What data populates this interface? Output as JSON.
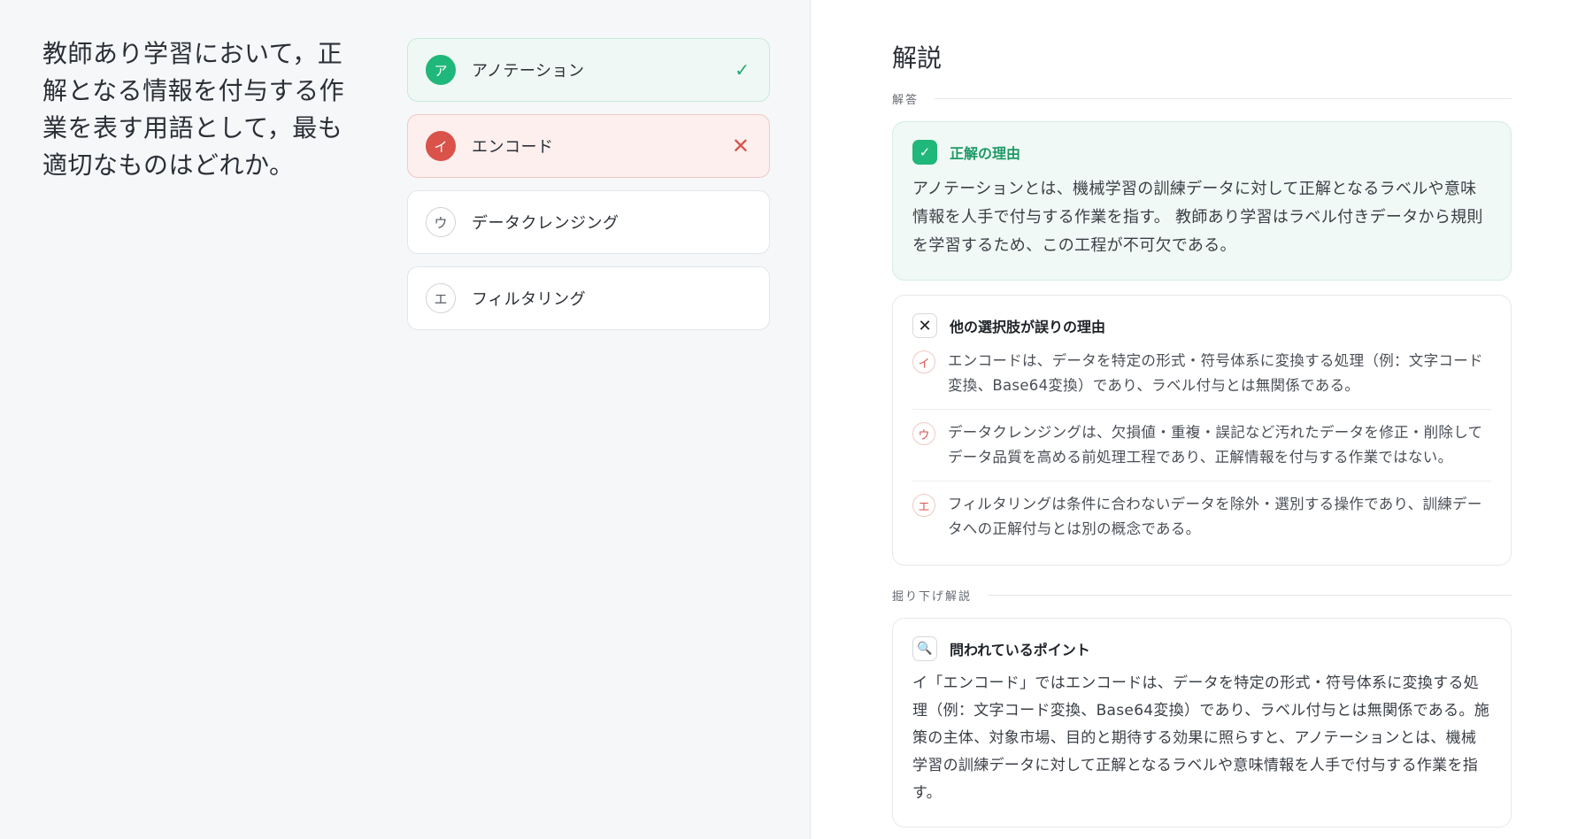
{
  "question": {
    "text": "教師あり学習において，正解となる情報を付与する作業を表す用語として，最も適切なものはどれか。"
  },
  "options": [
    {
      "letter": "ア",
      "label": "アノテーション",
      "state": "correct",
      "mark": "✓"
    },
    {
      "letter": "イ",
      "label": "エンコード",
      "state": "wrong",
      "mark": "✕"
    },
    {
      "letter": "ウ",
      "label": "データクレンジング",
      "state": "neutral",
      "mark": ""
    },
    {
      "letter": "エ",
      "label": "フィルタリング",
      "state": "neutral",
      "mark": ""
    }
  ],
  "explanation": {
    "title": "解説",
    "answer_section": "解答",
    "correct_reason": {
      "icon": "✓",
      "title": "正解の理由",
      "text": "アノテーションとは、機械学習の訓練データに対して正解となるラベルや意味情報を人手で付与する作業を指す。 教師あり学習はラベル付きデータから規則を学習するため、この工程が不可欠である。"
    },
    "wrong_reasons": {
      "icon": "✕",
      "title": "他の選択肢が誤りの理由",
      "items": [
        {
          "letter": "イ",
          "text": "エンコードは、データを特定の形式・符号体系に変換する処理（例：文字コード変換、Base64変換）であり、ラベル付与とは無関係である。"
        },
        {
          "letter": "ウ",
          "text": "データクレンジングは、欠損値・重複・誤記など汚れたデータを修正・削除してデータ品質を高める前処理工程であり、正解情報を付与する作業ではない。"
        },
        {
          "letter": "エ",
          "text": "フィルタリングは条件に合わないデータを除外・選別する操作であり、訓練データへの正解付与とは別の概念である。"
        }
      ]
    },
    "deep_section": "掘り下げ解説",
    "points": {
      "icon": "🔍",
      "title": "問われているポイント",
      "text": "イ「エンコード」ではエンコードは、データを特定の形式・符号体系に変換する処理（例：文字コード変換、Base64変換）であり、ラベル付与とは無関係である。施策の主体、対象市場、目的と期待する効果に照らすと、アノテーションとは、機械学習の訓練データに対して正解となるラベルや意味情報を人手で付与する作業を指す。"
    }
  }
}
